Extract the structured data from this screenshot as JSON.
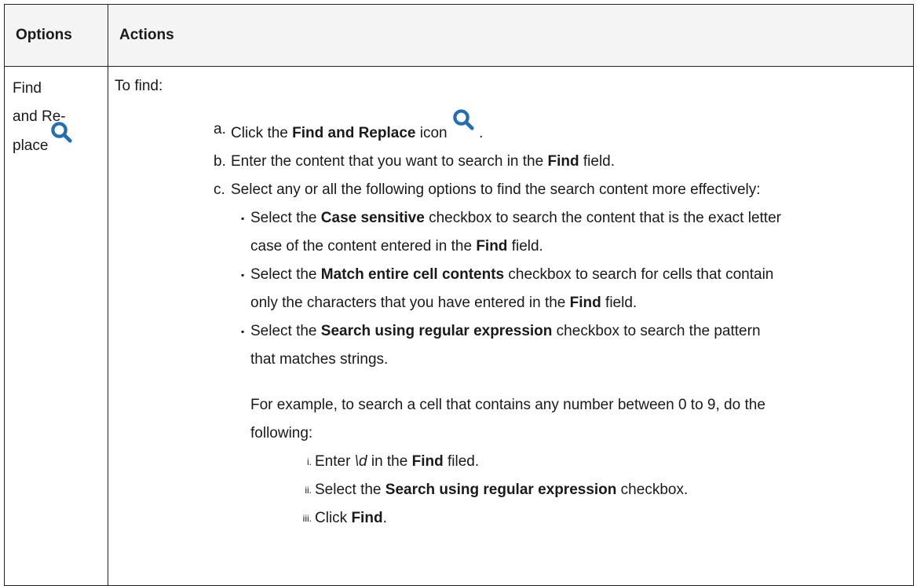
{
  "table": {
    "headers": [
      "Options",
      "Actions"
    ],
    "option": {
      "lines": [
        "Find",
        "and Re-",
        "place"
      ],
      "icon": "search-icon"
    },
    "actions": {
      "intro": "To find:",
      "steps": [
        {
          "marker": "a.",
          "parts": [
            {
              "t": "Click the "
            },
            {
              "b": "Find and Replace"
            },
            {
              "t": " icon "
            },
            {
              "icon": "search-icon"
            },
            {
              "t": " ."
            }
          ]
        },
        {
          "marker": "b.",
          "parts": [
            {
              "t": "Enter the content that you want to search in the "
            },
            {
              "b": "Find"
            },
            {
              "t": " field."
            }
          ]
        },
        {
          "marker": "c.",
          "parts": [
            {
              "t": "Select any or all the following options to find the search content more effectively:"
            }
          ],
          "bullets": [
            {
              "parts": [
                {
                  "t": "Select the "
                },
                {
                  "b": "Case sensitive"
                },
                {
                  "t": " checkbox to search the content that is the exact letter case of the content entered in the "
                },
                {
                  "b": "Find"
                },
                {
                  "t": " field."
                }
              ]
            },
            {
              "parts": [
                {
                  "t": "Select the "
                },
                {
                  "b": "Match entire cell contents"
                },
                {
                  "t": " checkbox to search for cells that contain only the characters that you have entered in the "
                },
                {
                  "b": "Find"
                },
                {
                  "t": " field."
                }
              ]
            },
            {
              "parts": [
                {
                  "t": "Select the "
                },
                {
                  "b": "Search using regular expression"
                },
                {
                  "t": " checkbox to search the pattern that matches strings."
                }
              ],
              "example": "For example, to search a cell that contains any number between 0 to 9, do the following:",
              "substeps": [
                {
                  "marker": "i.",
                  "parts": [
                    {
                      "t": "Enter "
                    },
                    {
                      "i": "\\d"
                    },
                    {
                      "t": " in the "
                    },
                    {
                      "b": "Find"
                    },
                    {
                      "t": " filed."
                    }
                  ]
                },
                {
                  "marker": "ii.",
                  "parts": [
                    {
                      "t": "Select the "
                    },
                    {
                      "b": "Search using regular expression"
                    },
                    {
                      "t": " checkbox."
                    }
                  ]
                },
                {
                  "marker": "iii.",
                  "parts": [
                    {
                      "t": "Click "
                    },
                    {
                      "b": "Find"
                    },
                    {
                      "t": "."
                    }
                  ]
                }
              ]
            }
          ]
        }
      ]
    }
  },
  "colors": {
    "icon": "#1f6fb2",
    "border": "#222222",
    "text": "#1a1a1a"
  },
  "bullet_marker": "▪"
}
